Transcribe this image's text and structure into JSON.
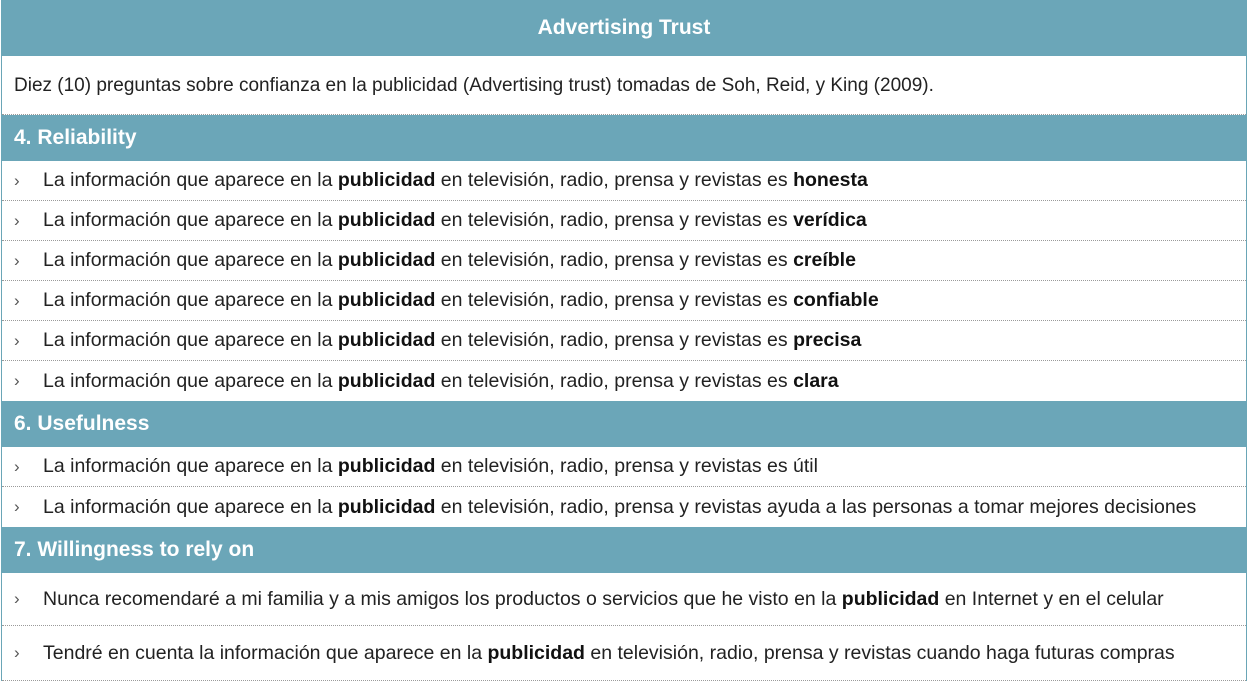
{
  "title": "Advertising Trust",
  "intro": "Diez (10) preguntas sobre confianza en la publicidad (Advertising trust) tomadas de Soh, Reid, y King (2009).",
  "bullet_glyph": "›",
  "common": {
    "prefix": "La información que aparece en la ",
    "keyword": "publicidad",
    "middle": " en televisión, radio, prensa y revistas es "
  },
  "sections": [
    {
      "heading": "4. Reliability",
      "items": [
        "honesta",
        "verídica",
        "creíble",
        "confiable",
        "precisa",
        "clara"
      ]
    },
    {
      "heading": "6. Usefulness",
      "items": [
        {
          "before": "La información que aparece en la ",
          "bold": "publicidad",
          "after": " en televisión, radio, prensa y revistas es útil"
        },
        {
          "before": "La información que aparece en la ",
          "bold": "publicidad",
          "after": " en televisión, radio, prensa y revistas ayuda a las personas a tomar mejores decisiones"
        }
      ]
    },
    {
      "heading": "7. Willingness to rely on",
      "items": [
        {
          "before": "Nunca recomendaré a mi familia y a mis amigos los productos o servicios que he visto en la ",
          "bold": "publicidad",
          "after": " en Internet y en el celular"
        },
        {
          "before": "Tendré en cuenta la información que aparece en la ",
          "bold": "publicidad",
          "after": " en televisión, radio, prensa y revistas cuando haga futuras compras"
        }
      ]
    }
  ],
  "colors": {
    "header_bg": "#6ba6b8",
    "header_text": "#ffffff",
    "body_text": "#222222",
    "divider": "#9a9a9a"
  }
}
